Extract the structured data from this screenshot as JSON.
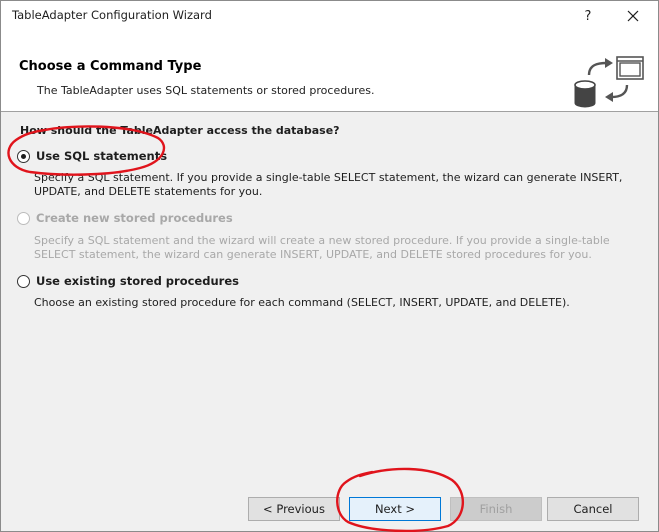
{
  "window": {
    "title": "TableAdapter Configuration Wizard",
    "help_label": "?",
    "close_label": "✕"
  },
  "header": {
    "title": "Choose a Command Type",
    "description": "The TableAdapter uses SQL statements or stored procedures.",
    "icon": "database-command-icon"
  },
  "question": "How should the TableAdapter access the database?",
  "options": [
    {
      "label": "Use SQL statements",
      "checked": true,
      "enabled": true,
      "description": "Specify a SQL statement. If you provide a single-table SELECT statement, the wizard can generate INSERT, UPDATE, and DELETE statements for you."
    },
    {
      "label": "Create new stored procedures",
      "checked": false,
      "enabled": false,
      "description": "Specify a SQL statement and the wizard will create a new stored procedure. If you provide a single-table SELECT statement, the wizard can generate INSERT, UPDATE, and DELETE stored procedures for you."
    },
    {
      "label": "Use existing stored procedures",
      "checked": false,
      "enabled": true,
      "description": "Choose an existing stored procedure for each command (SELECT, INSERT, UPDATE, and DELETE)."
    }
  ],
  "buttons": {
    "previous": "< Previous",
    "next": "Next >",
    "finish": "Finish",
    "cancel": "Cancel"
  },
  "colors": {
    "annotation": "#e0141c",
    "default_button_border": "#0078d7",
    "content_background": "#f0f0f0"
  }
}
